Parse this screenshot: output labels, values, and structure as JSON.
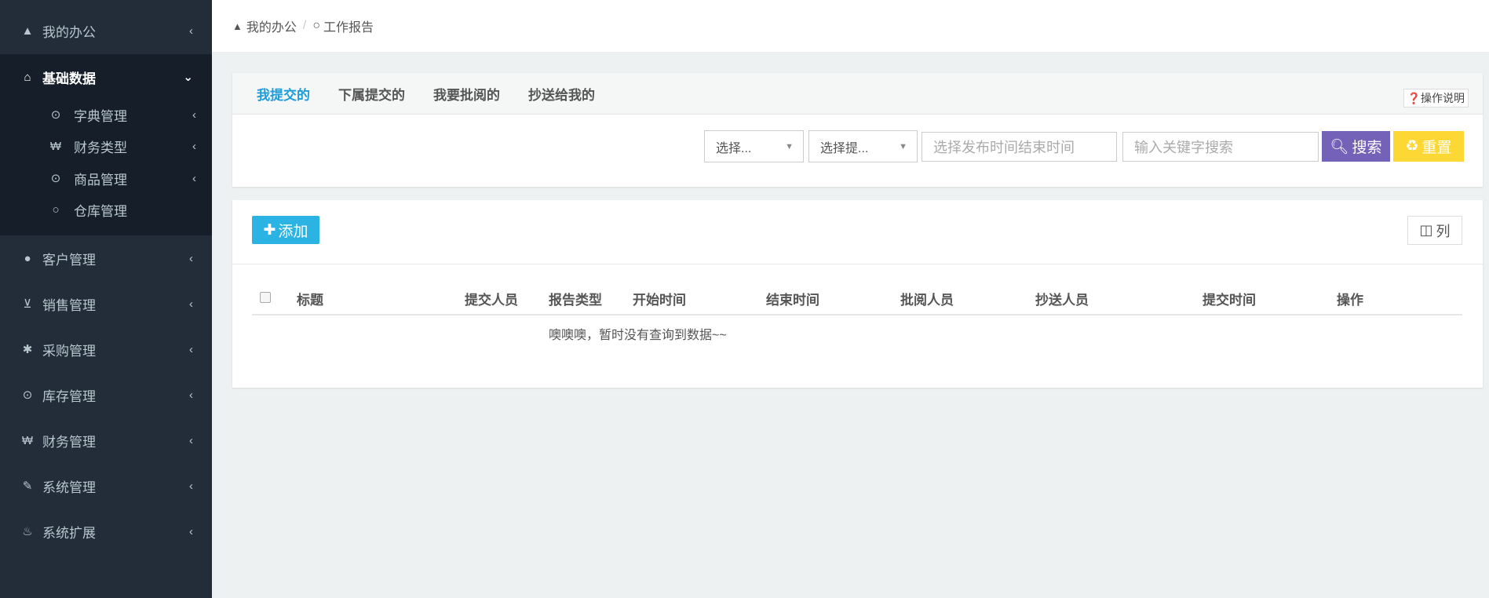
{
  "sidebar": {
    "top": {
      "label": "我的办公",
      "icon": "road-icon"
    },
    "active": {
      "label": "基础数据",
      "icon": "home-icon"
    },
    "sub": [
      {
        "label": "字典管理",
        "icon": "dot-circle-icon"
      },
      {
        "label": "财务类型",
        "icon": "won-icon"
      },
      {
        "label": "商品管理",
        "icon": "dot-circle-icon"
      },
      {
        "label": "仓库管理",
        "icon": "circle-icon"
      }
    ],
    "items": [
      {
        "label": "客户管理",
        "icon": "user-icon"
      },
      {
        "label": "销售管理",
        "icon": "cart-icon"
      },
      {
        "label": "采购管理",
        "icon": "asterisk-icon"
      },
      {
        "label": "库存管理",
        "icon": "dot-circle-icon"
      },
      {
        "label": "财务管理",
        "icon": "won-icon"
      },
      {
        "label": "系统管理",
        "icon": "wrench-icon"
      },
      {
        "label": "系统扩展",
        "icon": "fire-icon"
      }
    ]
  },
  "breadcrumb": {
    "home": "我的办公",
    "sep": "/",
    "current": "工作报告"
  },
  "tabs": [
    "我提交的",
    "下属提交的",
    "我要批阅的",
    "抄送给我的"
  ],
  "help_label": "操作说明",
  "filters": {
    "select1": "选择...",
    "select2": "选择提...",
    "date_placeholder": "选择发布时间结束时间",
    "keyword_placeholder": "输入关键字搜索",
    "search": "搜索",
    "reset": "重置"
  },
  "toolbar": {
    "add": "添加",
    "columns": "列"
  },
  "table": {
    "headers": [
      "标题",
      "提交人员",
      "报告类型",
      "开始时间",
      "结束时间",
      "批阅人员",
      "抄送人员",
      "提交时间",
      "操作"
    ],
    "empty": "噢噢噢，暂时没有查询到数据~~"
  },
  "colors": {
    "accent": "#1e9cd8",
    "search": "#7461b8",
    "reset": "#fdd835",
    "add": "#2bb4e3"
  }
}
